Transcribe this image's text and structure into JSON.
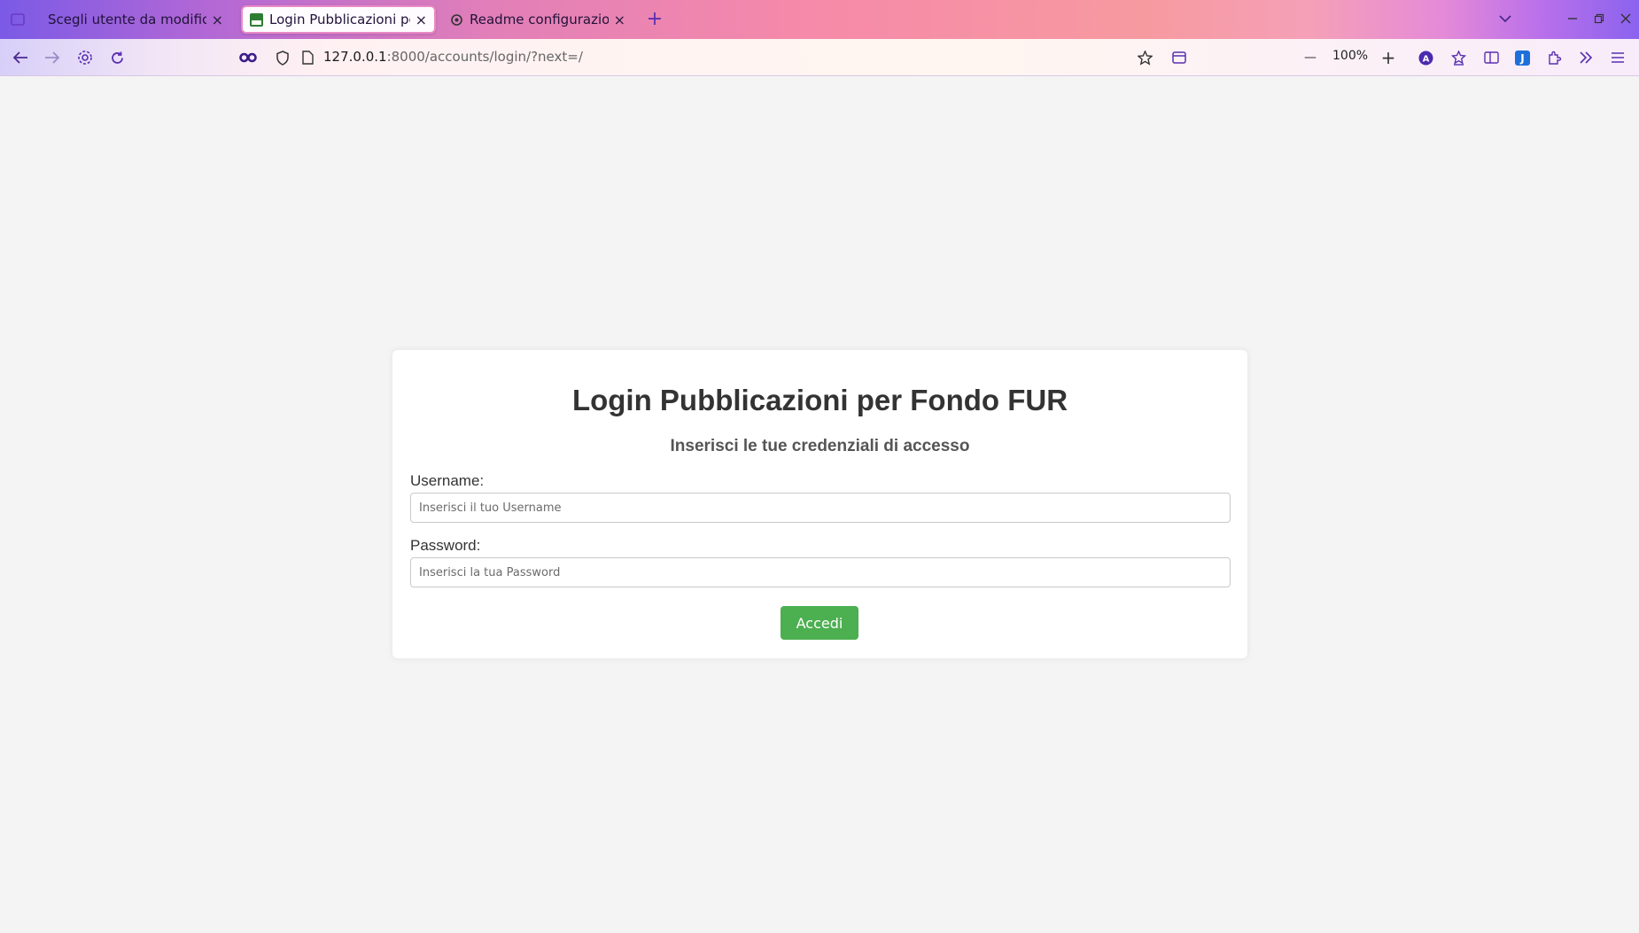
{
  "browser": {
    "tabs": [
      {
        "title": "Scegli utente da modificare |",
        "close": "×"
      },
      {
        "title": "Login Pubblicazioni per F",
        "close": "×"
      },
      {
        "title": "Readme configurazione e",
        "close": "×"
      }
    ],
    "new_tab": "+",
    "url_host": "127.0.0.1",
    "url_path": ":8000/accounts/login/?next=/",
    "zoom": "100%",
    "zoom_out": "—",
    "zoom_in": "+"
  },
  "page": {
    "title": "Login Pubblicazioni per Fondo FUR",
    "subtitle": "Inserisci le tue credenziali di accesso",
    "username_label": "Username:",
    "username_placeholder": "Inserisci il tuo Username",
    "password_label": "Password:",
    "password_placeholder": "Inserisci la tua Password",
    "submit_label": "Accedi"
  },
  "colors": {
    "button": "#4caf50",
    "background": "#f4f4f4",
    "accent": "#5a2fb0"
  }
}
